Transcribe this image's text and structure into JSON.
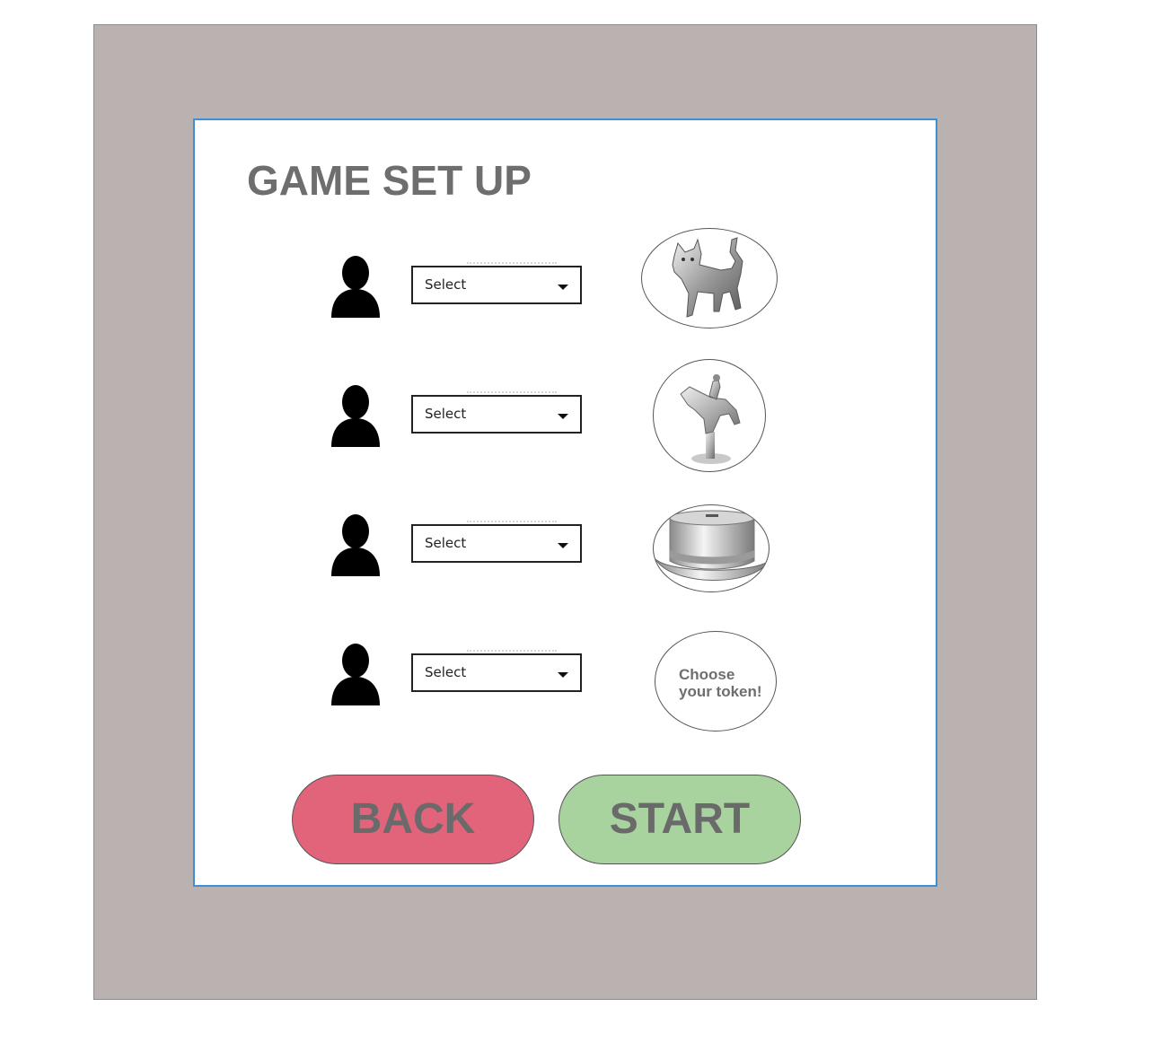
{
  "screen": {
    "title": "GAME SET UP"
  },
  "players": [
    {
      "select_label": "Select",
      "token": {
        "icon": "cat-token",
        "label": ""
      }
    },
    {
      "select_label": "Select",
      "token": {
        "icon": "horse-rider-token",
        "label": ""
      }
    },
    {
      "select_label": "Select",
      "token": {
        "icon": "top-hat-token",
        "label": ""
      }
    },
    {
      "select_label": "Select",
      "token": {
        "icon": "",
        "label": "Choose\nyour token!"
      }
    }
  ],
  "buttons": {
    "back_label": "BACK",
    "start_label": "START"
  },
  "colors": {
    "frame": "#bab2b1",
    "panel_border": "#3d8fd6",
    "back_button": "#e2647a",
    "start_button": "#a8d29e",
    "title_text": "#6e6e6e"
  }
}
